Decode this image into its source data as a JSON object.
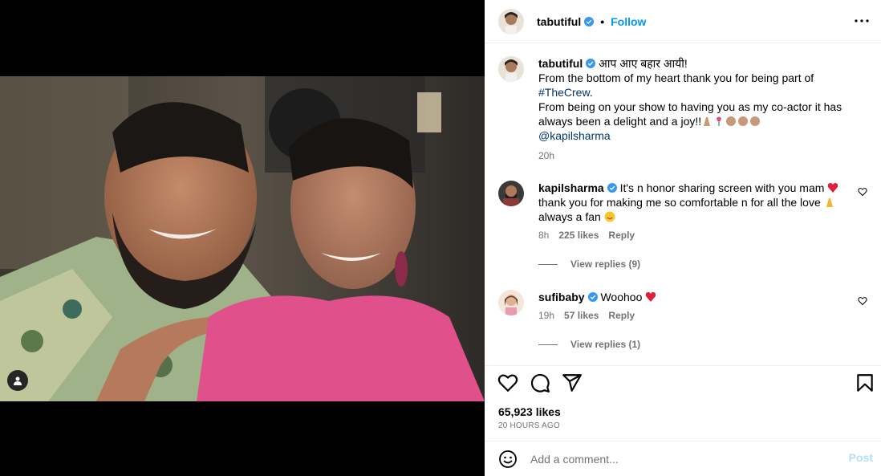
{
  "post": {
    "author": "tabutiful",
    "dot": "•",
    "follow_label": "Follow",
    "caption": {
      "author": "tabutiful",
      "line1": "आप आए बहार आयी!",
      "line2": "From the bottom of my heart thank you for being part of",
      "hashtag": "#TheCrew",
      "line2_end": ".",
      "line3": "From being on your show to having you as my co-actor it has always been a delight and a joy!!",
      "mention": "@kapilsharma",
      "age": "20h"
    },
    "comments": [
      {
        "author": "kapilsharma",
        "text_a": "It's n honor sharing screen with you mam",
        "text_b": "thank you for making me so comfortable n for all the love",
        "text_c": "always a fan",
        "age": "8h",
        "likes": "225 likes",
        "reply_label": "Reply",
        "view_replies": "View replies (9)"
      },
      {
        "author": "sufibaby",
        "text_a": "Woohoo",
        "age": "19h",
        "likes": "57 likes",
        "reply_label": "Reply",
        "view_replies": "View replies (1)"
      }
    ],
    "likes_count": "65,923 likes",
    "posted_ago": "20 HOURS AGO",
    "comment_placeholder": "Add a comment...",
    "post_label": "Post"
  },
  "icons": {
    "verified": "verified-badge-icon",
    "more": "more-options-icon",
    "like": "heart-icon",
    "comment": "comment-icon",
    "share": "share-icon",
    "save": "bookmark-icon",
    "emoji": "emoji-icon",
    "tag": "user-tag-icon"
  },
  "colors": {
    "accent": "#0095f6",
    "link": "#00376b",
    "muted": "#737373",
    "verified": "#3897f0",
    "post_disabled": "#b2dffc"
  }
}
